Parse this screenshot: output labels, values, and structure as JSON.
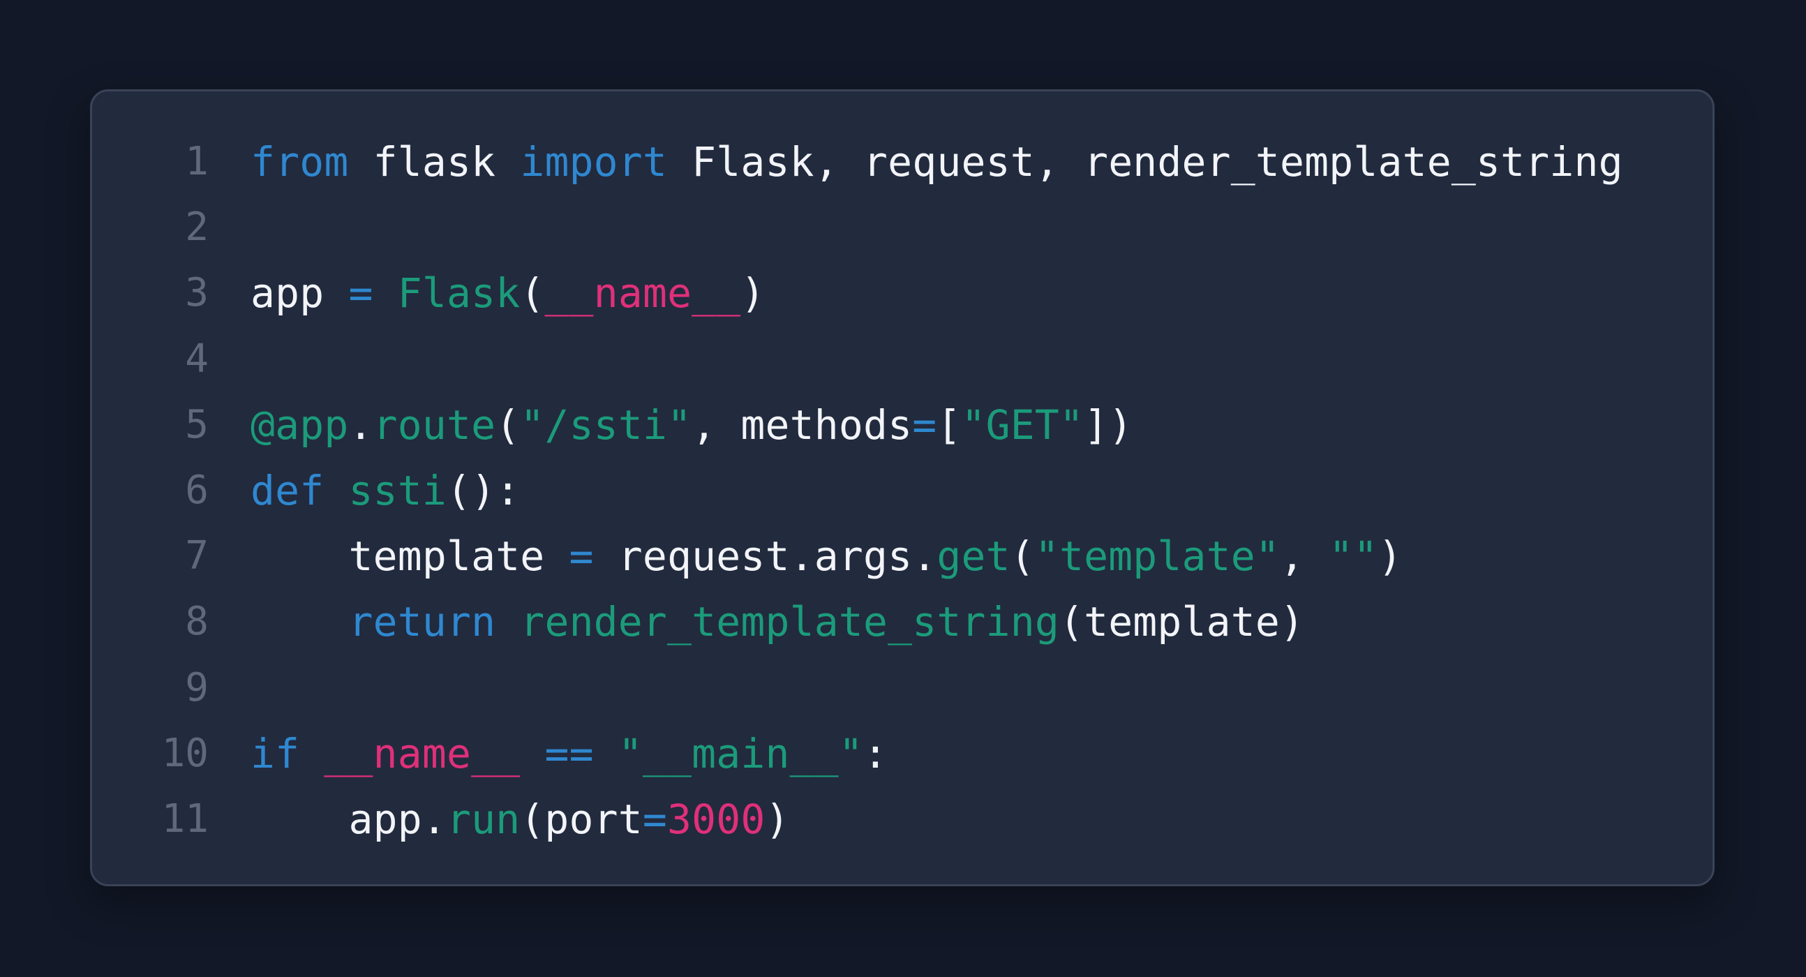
{
  "colors": {
    "background": "#121827",
    "panel": "#222a3e",
    "keyword": "#2f88d0",
    "text": "#f2f4f8",
    "function_call": "#1b9b7a",
    "string": "#1b9b7a",
    "dunder": "#e0307a",
    "number": "#e0307a",
    "line_number": "#5f687c"
  },
  "lines": [
    {
      "number": "1",
      "tokens": [
        {
          "text": "from",
          "kind": "keyword"
        },
        {
          "text": " flask ",
          "kind": "plain"
        },
        {
          "text": "import",
          "kind": "keyword"
        },
        {
          "text": " Flask, request, render_template_string",
          "kind": "plain"
        }
      ]
    },
    {
      "number": "2",
      "tokens": []
    },
    {
      "number": "3",
      "tokens": [
        {
          "text": "app ",
          "kind": "plain"
        },
        {
          "text": "=",
          "kind": "operator"
        },
        {
          "text": " ",
          "kind": "plain"
        },
        {
          "text": "Flask",
          "kind": "call"
        },
        {
          "text": "(",
          "kind": "punct"
        },
        {
          "text": "__name__",
          "kind": "dunder"
        },
        {
          "text": ")",
          "kind": "punct"
        }
      ]
    },
    {
      "number": "4",
      "tokens": []
    },
    {
      "number": "5",
      "tokens": [
        {
          "text": "@app",
          "kind": "call"
        },
        {
          "text": ".",
          "kind": "plain"
        },
        {
          "text": "route",
          "kind": "call"
        },
        {
          "text": "(",
          "kind": "punct"
        },
        {
          "text": "\"/ssti\"",
          "kind": "string"
        },
        {
          "text": ", methods",
          "kind": "plain"
        },
        {
          "text": "=",
          "kind": "operator"
        },
        {
          "text": "[",
          "kind": "punct"
        },
        {
          "text": "\"GET\"",
          "kind": "string"
        },
        {
          "text": "])",
          "kind": "punct"
        }
      ]
    },
    {
      "number": "6",
      "tokens": [
        {
          "text": "def",
          "kind": "keyword"
        },
        {
          "text": " ",
          "kind": "plain"
        },
        {
          "text": "ssti",
          "kind": "call"
        },
        {
          "text": "():",
          "kind": "punct"
        }
      ]
    },
    {
      "number": "7",
      "tokens": [
        {
          "text": "    template ",
          "kind": "plain"
        },
        {
          "text": "=",
          "kind": "operator"
        },
        {
          "text": " request.args.",
          "kind": "plain"
        },
        {
          "text": "get",
          "kind": "call"
        },
        {
          "text": "(",
          "kind": "punct"
        },
        {
          "text": "\"template\"",
          "kind": "string"
        },
        {
          "text": ", ",
          "kind": "plain"
        },
        {
          "text": "\"\"",
          "kind": "string"
        },
        {
          "text": ")",
          "kind": "punct"
        }
      ]
    },
    {
      "number": "8",
      "tokens": [
        {
          "text": "    ",
          "kind": "plain"
        },
        {
          "text": "return",
          "kind": "keyword"
        },
        {
          "text": " ",
          "kind": "plain"
        },
        {
          "text": "render_template_string",
          "kind": "call"
        },
        {
          "text": "(template)",
          "kind": "punct"
        }
      ]
    },
    {
      "number": "9",
      "tokens": []
    },
    {
      "number": "10",
      "tokens": [
        {
          "text": "if",
          "kind": "keyword"
        },
        {
          "text": " ",
          "kind": "plain"
        },
        {
          "text": "__name__",
          "kind": "dunder"
        },
        {
          "text": " ",
          "kind": "plain"
        },
        {
          "text": "==",
          "kind": "operator"
        },
        {
          "text": " ",
          "kind": "plain"
        },
        {
          "text": "\"__main__\"",
          "kind": "string"
        },
        {
          "text": ":",
          "kind": "punct"
        }
      ]
    },
    {
      "number": "11",
      "tokens": [
        {
          "text": "    app.",
          "kind": "plain"
        },
        {
          "text": "run",
          "kind": "call"
        },
        {
          "text": "(port",
          "kind": "plain"
        },
        {
          "text": "=",
          "kind": "operator"
        },
        {
          "text": "3000",
          "kind": "number"
        },
        {
          "text": ")",
          "kind": "punct"
        }
      ]
    }
  ]
}
